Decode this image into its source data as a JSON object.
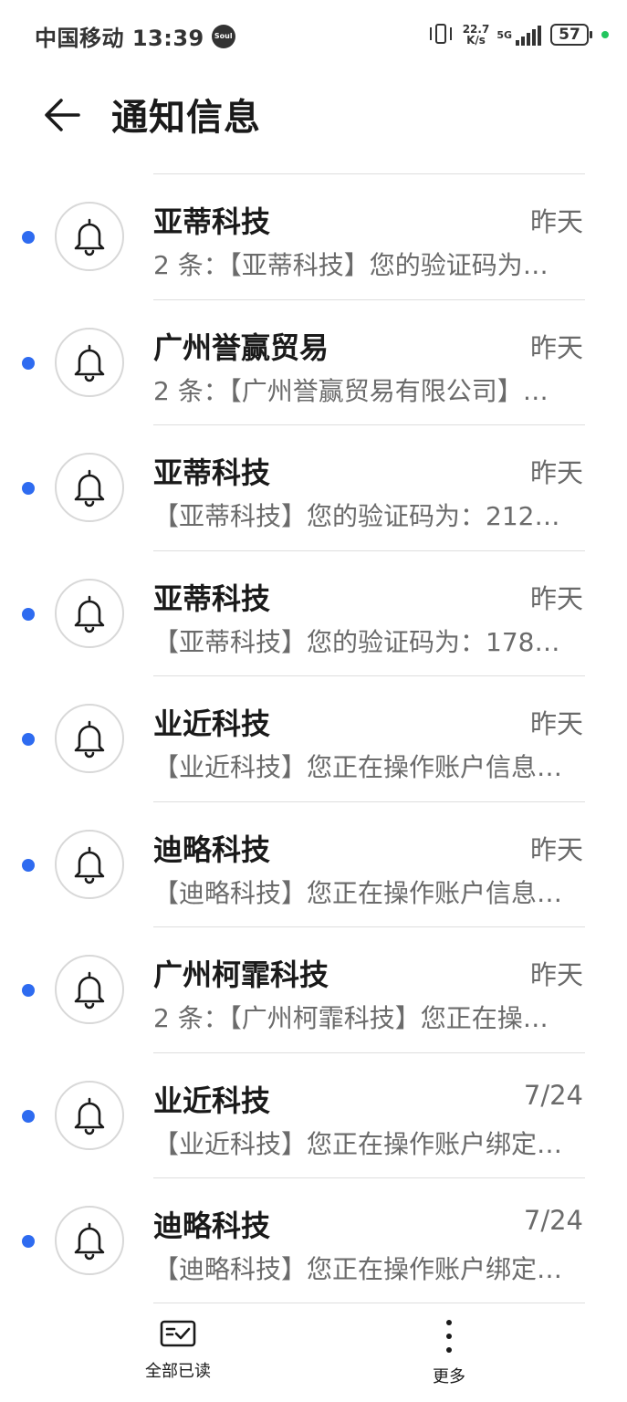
{
  "status_bar": {
    "carrier_time": "中国移动 13:39",
    "soul_badge": "Soul",
    "net_speed_value": "22.7",
    "net_speed_unit": "K/s",
    "network_type": "5G",
    "battery": "57"
  },
  "header": {
    "back_icon": "arrow-left-icon",
    "title": "通知信息"
  },
  "messages": [
    {
      "sender": "亚蒂科技",
      "time": "昨天",
      "preview": "2 条：【亚蒂科技】您的验证码为…",
      "unread": true
    },
    {
      "sender": "广州誉赢贸易",
      "time": "昨天",
      "preview": "2 条：【广州誉赢贸易有限公司】…",
      "unread": true
    },
    {
      "sender": "亚蒂科技",
      "time": "昨天",
      "preview": "【亚蒂科技】您的验证码为：212…",
      "unread": true
    },
    {
      "sender": "亚蒂科技",
      "time": "昨天",
      "preview": "【亚蒂科技】您的验证码为：178…",
      "unread": true
    },
    {
      "sender": "业近科技",
      "time": "昨天",
      "preview": "【业近科技】您正在操作账户信息…",
      "unread": true
    },
    {
      "sender": "迪略科技",
      "time": "昨天",
      "preview": "【迪略科技】您正在操作账户信息…",
      "unread": true
    },
    {
      "sender": "广州柯霏科技",
      "time": "昨天",
      "preview": "2 条：【广州柯霏科技】您正在操…",
      "unread": true
    },
    {
      "sender": "业近科技",
      "time": "7/24",
      "preview": "【业近科技】您正在操作账户绑定…",
      "unread": true
    },
    {
      "sender": "迪略科技",
      "time": "7/24",
      "preview": "【迪略科技】您正在操作账户绑定…",
      "unread": true
    }
  ],
  "bottom_bar": {
    "mark_all_read": "全部已读",
    "more": "更多"
  },
  "colors": {
    "unread_dot": "#2e6bf0",
    "text_primary": "#1a1a1a",
    "text_secondary": "#6b6b6b",
    "status_green": "#22c55e"
  }
}
